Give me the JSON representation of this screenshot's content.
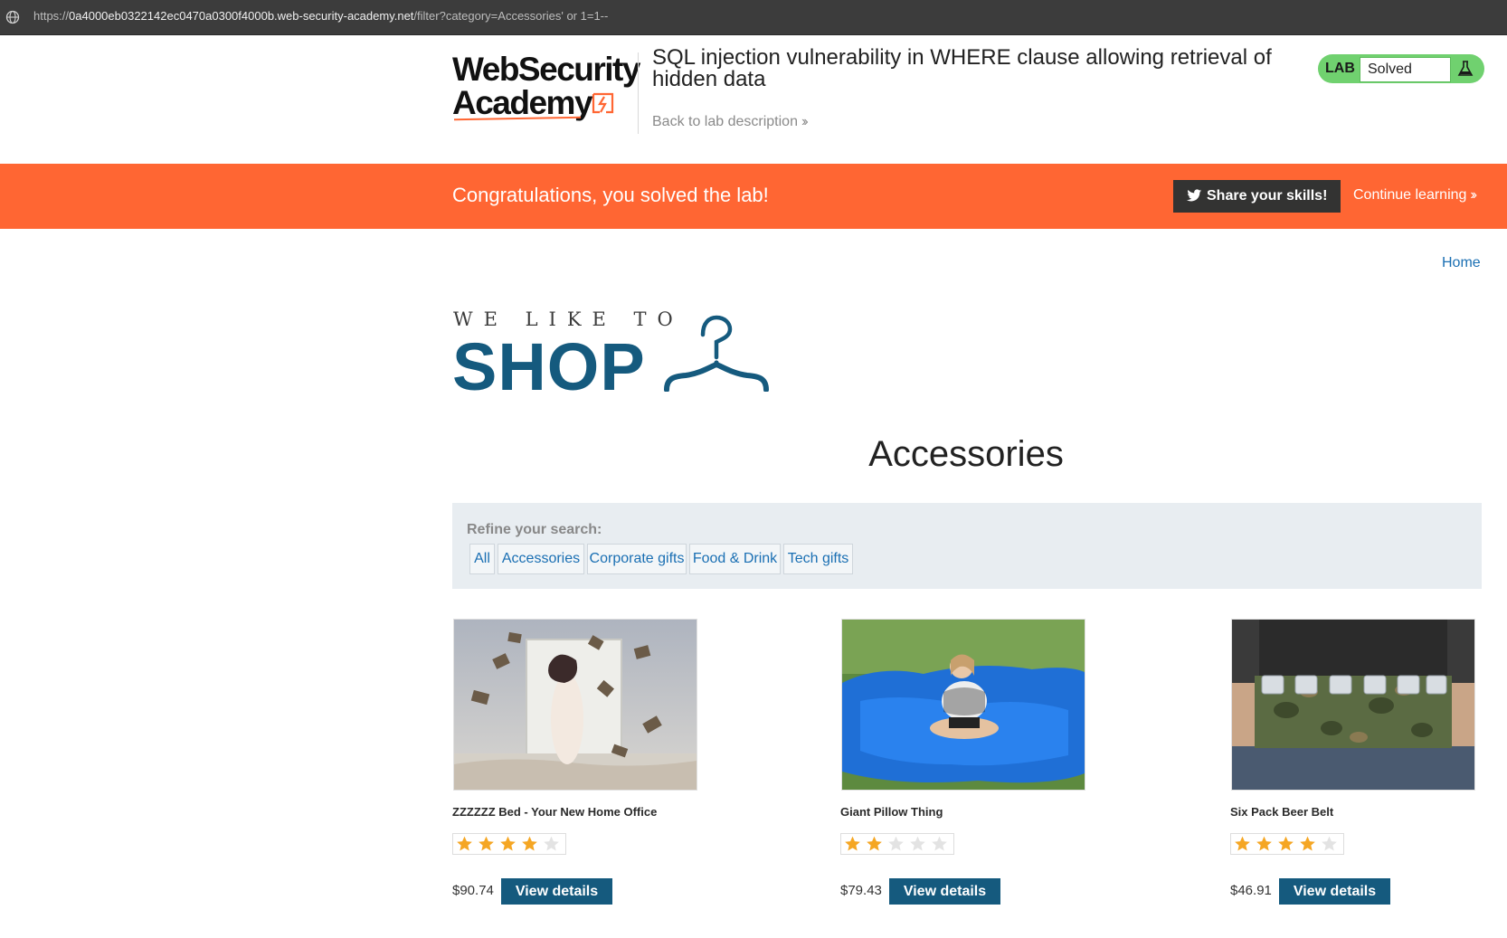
{
  "browser": {
    "url_prefix": "https://",
    "url_host": "0a4000eb0322142ec0470a0300f4000b.web-security-academy.net",
    "url_path": "/filter?category=Accessories' or 1=1--"
  },
  "lab_header": {
    "logo_line1": "WebSecurity",
    "logo_line2": "Academy",
    "title": "SQL injection vulnerability in WHERE clause allowing retrieval of hidden data",
    "back_link": "Back to lab description",
    "badge_label": "LAB",
    "badge_status": "Solved"
  },
  "banner": {
    "message": "Congratulations, you solved the lab!",
    "share_label": "Share your skills!",
    "continue_label": "Continue learning"
  },
  "shop": {
    "home_link": "Home",
    "logo_tagline": "WE LIKE TO",
    "logo_word": "SHOP",
    "category_heading": "Accessories",
    "refine_label": "Refine your search:",
    "filters": [
      "All",
      "Accessories",
      "Corporate gifts",
      "Food & Drink",
      "Tech gifts"
    ]
  },
  "products": [
    {
      "name": "ZZZZZZ Bed - Your New Home Office",
      "rating": 4,
      "price": "$90.74",
      "button": "View details"
    },
    {
      "name": "Giant Pillow Thing",
      "rating": 2,
      "price": "$79.43",
      "button": "View details"
    },
    {
      "name": "Six Pack Beer Belt",
      "rating": 4,
      "price": "$46.91",
      "button": "View details"
    }
  ],
  "colors": {
    "accent_orange": "#ff6633",
    "shop_blue": "#155a7e",
    "link_blue": "#1a6fb3",
    "badge_green": "#70d16f",
    "star_gold": "#f5a623"
  },
  "icons": [
    "globe-icon",
    "academy-logo-mark",
    "flask-icon",
    "twitter-bird-icon",
    "chevron-right-icon",
    "hanger-icon",
    "star-icon"
  ]
}
